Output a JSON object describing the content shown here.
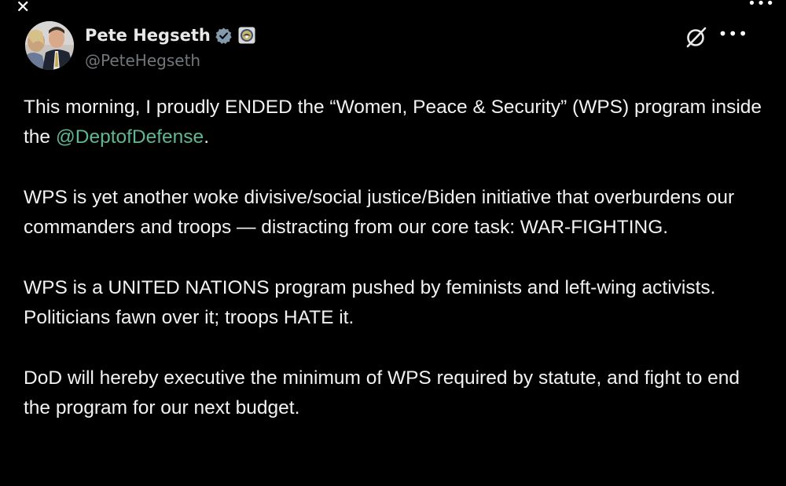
{
  "window": {
    "close_glyph": "✕",
    "more_glyph": "•••"
  },
  "author": {
    "display_name": "Pete Hegseth",
    "handle": "@PeteHegseth",
    "verified_icon": "verified-check-icon",
    "affiliation_icon": "department-seal-icon"
  },
  "actions": {
    "grok_icon": "grok-icon",
    "more_glyph": "•••"
  },
  "tweet": {
    "p1_before": "This morning, I proudly ENDED the “Women, Peace & Security” (WPS) program inside the ",
    "p1_mention": "@DeptofDefense",
    "p1_after": ".",
    "p2": "WPS is yet another woke divisive/social justice/Biden initiative that overburdens our commanders and troops — distracting from our core task: WAR-FIGHTING.",
    "p3": "WPS is a UNITED NATIONS program pushed by feminists and left-wing activists. Politicians fawn over it; troops HATE it.",
    "p4": "DoD will hereby executive the minimum of WPS required by statute, and fight to end the program for our next budget."
  },
  "colors": {
    "background": "#000000",
    "text": "#e7e9ea",
    "secondary_text": "#71767b",
    "mention": "#5fb893",
    "verified": "#829aab"
  }
}
